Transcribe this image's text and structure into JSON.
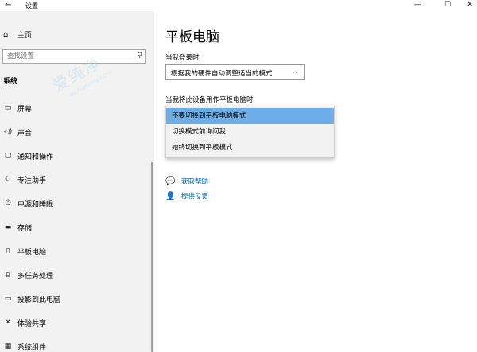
{
  "window": {
    "title": "设置",
    "back_icon": "←",
    "controls": {
      "minimize": "—",
      "maximize": "☐",
      "close": "✕"
    }
  },
  "sidebar": {
    "home": {
      "icon": "home-icon",
      "label": "主页"
    },
    "search": {
      "placeholder": "查找设置",
      "icon": "search-icon"
    },
    "section": "系统",
    "items": [
      {
        "key": "display",
        "icon": "monitor-icon",
        "label": "屏幕"
      },
      {
        "key": "sound",
        "icon": "speaker-icon",
        "label": "声音"
      },
      {
        "key": "notifications",
        "icon": "notification-icon",
        "label": "通知和操作"
      },
      {
        "key": "focus",
        "icon": "moon-icon",
        "label": "专注助手"
      },
      {
        "key": "power",
        "icon": "power-icon",
        "label": "电源和睡眠"
      },
      {
        "key": "storage",
        "icon": "storage-icon",
        "label": "存储"
      },
      {
        "key": "tablet",
        "icon": "tablet-icon",
        "label": "平板电脑"
      },
      {
        "key": "multitasking",
        "icon": "multitask-icon",
        "label": "多任务处理"
      },
      {
        "key": "projecting",
        "icon": "projector-icon",
        "label": "投影到此电脑"
      },
      {
        "key": "shared",
        "icon": "share-icon",
        "label": "体验共享"
      },
      {
        "key": "components",
        "icon": "components-icon",
        "label": "系统组件"
      }
    ]
  },
  "watermark": {
    "text_big": "爱纯净",
    "text_small": "aichunjing.com"
  },
  "main": {
    "title": "平板电脑",
    "login_label": "当我登录时",
    "login_value": "根据我的硬件自动调整适当的模式",
    "tablet_label": "当我将此设备用作平板电脑时",
    "options": [
      {
        "label": "不要切换到平板电脑模式",
        "selected": true
      },
      {
        "label": "切换模式前询问我",
        "selected": false
      },
      {
        "label": "始终切换到平板模式",
        "selected": false
      }
    ],
    "help_link": "获取帮助",
    "feedback_link": "提供反馈"
  },
  "colors": {
    "selected": "#6eaee8",
    "link": "#0067c0",
    "sidebar_bg": "#f2f2f2"
  }
}
